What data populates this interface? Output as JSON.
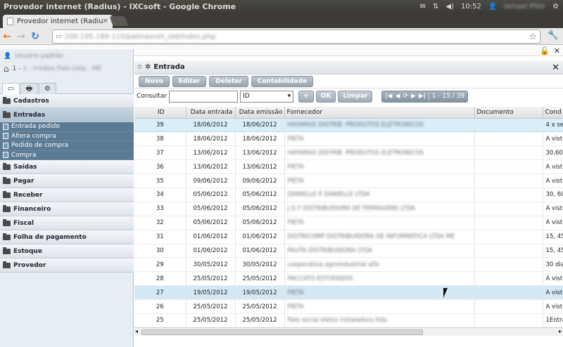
{
  "os": {
    "window_title": "Provedor internet (Radius) - IXCsoft - Google Chrome",
    "time": "10:52",
    "user": "Ismael Pfeir"
  },
  "browser": {
    "tab_title": "Provedor internet (Radius",
    "url": "200.195.189.110/palmasnet_old/index.php"
  },
  "sidebar": {
    "user_name": "Usuario padrão",
    "company": "1 - Irmãos Palo Ltda - ME",
    "menu": [
      {
        "label": "Cadastros"
      },
      {
        "label": "Entradas",
        "active": true
      },
      {
        "label": "Saídas"
      },
      {
        "label": "Pagar"
      },
      {
        "label": "Receber"
      },
      {
        "label": "Financeiro"
      },
      {
        "label": "Fiscal"
      },
      {
        "label": "Folha de pagamento"
      },
      {
        "label": "Estoque"
      },
      {
        "label": "Provedor"
      }
    ],
    "entradas_sub": [
      "Entrada pedido",
      "Altera compra",
      "Pedido de compra",
      "Compra"
    ]
  },
  "main": {
    "title": "Entrada",
    "buttons": [
      "Novo",
      "Editar",
      "Deletar",
      "Contabilidade"
    ],
    "search_label": "Consultar",
    "search_value": "",
    "filter_select": "ID",
    "add_btn": "+",
    "ok_btn": "OK",
    "clear_btn": "Limpar",
    "pager_text": "1 - 15 / 39",
    "columns": [
      "ID",
      "Data entrada",
      "Data emissão",
      "Fornecedor",
      "Documento",
      "Cond"
    ],
    "rows": [
      {
        "id": "39",
        "entrada": "18/06/2012",
        "emissao": "18/06/2012",
        "fornecedor": "HAYAMAX DISTRIB. PRODUTOS ELETRONICOS",
        "documento": "",
        "cond": "4 x se",
        "state": "selected"
      },
      {
        "id": "38",
        "entrada": "18/06/2012",
        "emissao": "18/06/2012",
        "fornecedor": "PIETA",
        "documento": "",
        "cond": "A vist"
      },
      {
        "id": "37",
        "entrada": "13/06/2012",
        "emissao": "13/06/2012",
        "fornecedor": "HAYAMAX DISTRIB. PRODUTOS ELETRONICOS",
        "documento": "",
        "cond": "30,60,"
      },
      {
        "id": "36",
        "entrada": "13/06/2012",
        "emissao": "13/06/2012",
        "fornecedor": "PIETA",
        "documento": "",
        "cond": "A vist"
      },
      {
        "id": "35",
        "entrada": "09/06/2012",
        "emissao": "09/06/2012",
        "fornecedor": "PIETA",
        "documento": "",
        "cond": "A vist"
      },
      {
        "id": "34",
        "entrada": "05/06/2012",
        "emissao": "05/06/2012",
        "fornecedor": "DANIELLE E DANIELLE LTDA",
        "documento": "",
        "cond": "30, 60"
      },
      {
        "id": "33",
        "entrada": "05/06/2012",
        "emissao": "05/06/2012",
        "fornecedor": "J G F DISTRIBUIDORA DE FERRAGENS LTDA",
        "documento": "",
        "cond": "A vist"
      },
      {
        "id": "32",
        "entrada": "05/06/2012",
        "emissao": "05/06/2012",
        "fornecedor": "PIETA",
        "documento": "",
        "cond": "A vist"
      },
      {
        "id": "31",
        "entrada": "01/06/2012",
        "emissao": "01/06/2012",
        "fornecedor": "DISTRICOMP DISTRIBUIDORA DE INFORMATICA LTDA ME",
        "documento": "",
        "cond": "15, 45"
      },
      {
        "id": "30",
        "entrada": "01/06/2012",
        "emissao": "01/06/2012",
        "fornecedor": "PAUTA DISTRIBUIDORA LTDA",
        "documento": "",
        "cond": "15, 45"
      },
      {
        "id": "29",
        "entrada": "30/05/2012",
        "emissao": "30/05/2012",
        "fornecedor": "cooperativa agroindustrial alfa",
        "documento": "",
        "cond": "30 dia"
      },
      {
        "id": "28",
        "entrada": "25/05/2012",
        "emissao": "25/05/2012",
        "fornecedor": "PACCATO ESTOFADOS",
        "documento": "",
        "cond": "A vist"
      },
      {
        "id": "27",
        "entrada": "19/05/2012",
        "emissao": "19/05/2012",
        "fornecedor": "PIETA",
        "documento": "",
        "cond": "A vist",
        "state": "hover"
      },
      {
        "id": "26",
        "entrada": "25/05/2012",
        "emissao": "25/05/2012",
        "fornecedor": "PIETA",
        "documento": "",
        "cond": "A vist"
      },
      {
        "id": "25",
        "entrada": "25/05/2012",
        "emissao": "25/05/2012",
        "fornecedor": "Palo social eletro instaladora ltda",
        "documento": "",
        "cond": "1Entra"
      }
    ]
  },
  "colors": {
    "sidebar_bg": "#e8edf2",
    "submenu_bg": "#5b7a94",
    "selected_row": "#d8eef8",
    "button": "#a5b0bb"
  }
}
